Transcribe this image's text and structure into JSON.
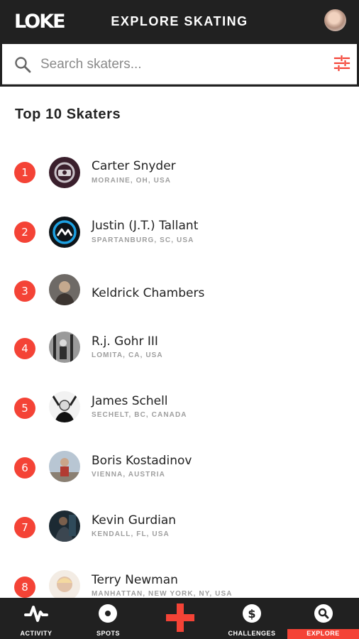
{
  "app": {
    "logo": "LOKE",
    "title": "EXPLORE SKATING"
  },
  "search": {
    "placeholder": "Search skaters...",
    "value": ""
  },
  "section": {
    "title": "Top 10 Skaters"
  },
  "skaters": [
    {
      "rank": "1",
      "name": "Carter Snyder",
      "location": "MORAINE, OH, USA"
    },
    {
      "rank": "2",
      "name": "Justin (J.T.) Tallant",
      "location": "SPARTANBURG, SC, USA"
    },
    {
      "rank": "3",
      "name": "Keldrick Chambers",
      "location": ""
    },
    {
      "rank": "4",
      "name": "R.j. Gohr III",
      "location": "LOMITA, CA, USA"
    },
    {
      "rank": "5",
      "name": "James Schell",
      "location": "SECHELT, BC, CANADA"
    },
    {
      "rank": "6",
      "name": "Boris Kostadinov",
      "location": "VIENNA, AUSTRIA"
    },
    {
      "rank": "7",
      "name": "Kevin Gurdian",
      "location": "KENDALL, FL, USA"
    },
    {
      "rank": "8",
      "name": "Terry Newman",
      "location": "MANHATTAN, NEW YORK, NY, USA"
    }
  ],
  "nav": {
    "activity": "ACTIVITY",
    "spots": "SPOTS",
    "challenges": "CHALLENGES",
    "explore": "EXPLORE",
    "active": "explore"
  },
  "colors": {
    "accent": "#f44336",
    "bar": "#212121"
  }
}
